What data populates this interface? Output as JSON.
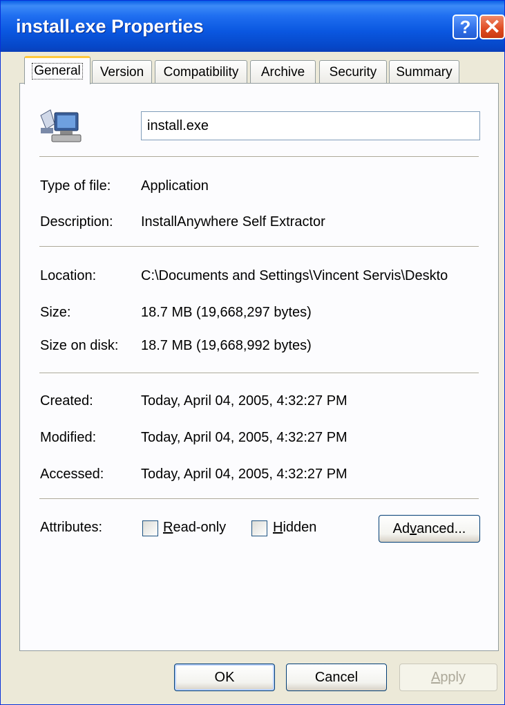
{
  "window": {
    "title": "install.exe Properties",
    "help_glyph": "?",
    "close_glyph": "✕"
  },
  "tabs": [
    {
      "label": "General",
      "active": true
    },
    {
      "label": "Version"
    },
    {
      "label": "Compatibility"
    },
    {
      "label": "Archive"
    },
    {
      "label": "Security"
    },
    {
      "label": "Summary"
    }
  ],
  "general": {
    "file_icon": "application-computer-icon",
    "file_name": "install.exe",
    "type_label": "Type of file:",
    "type_value": "Application",
    "description_label": "Description:",
    "description_value": "InstallAnywhere Self Extractor",
    "location_label": "Location:",
    "location_value": "C:\\Documents and Settings\\Vincent Servis\\Deskto",
    "size_label": "Size:",
    "size_value": "18.7 MB (19,668,297 bytes)",
    "size_on_disk_label": "Size on disk:",
    "size_on_disk_value": "18.7 MB (19,668,992 bytes)",
    "created_label": "Created:",
    "created_value": "Today, April 04, 2005, 4:32:27 PM",
    "modified_label": "Modified:",
    "modified_value": "Today, April 04, 2005, 4:32:27 PM",
    "accessed_label": "Accessed:",
    "accessed_value": "Today, April 04, 2005, 4:32:27 PM",
    "attributes_label": "Attributes:",
    "readonly_key": "R",
    "readonly_rest": "ead-only",
    "readonly_checked": false,
    "hidden_key": "H",
    "hidden_rest": "idden",
    "hidden_checked": false,
    "advanced_pre": "Ad",
    "advanced_key": "v",
    "advanced_post": "anced..."
  },
  "footer": {
    "ok_label": "OK",
    "cancel_label": "Cancel",
    "apply_key": "A",
    "apply_rest": "pply"
  },
  "colors": {
    "titlebar": "#0a57e0",
    "dialog_bg": "#ece9d8",
    "active_tab_accent": "#ffc83c"
  }
}
